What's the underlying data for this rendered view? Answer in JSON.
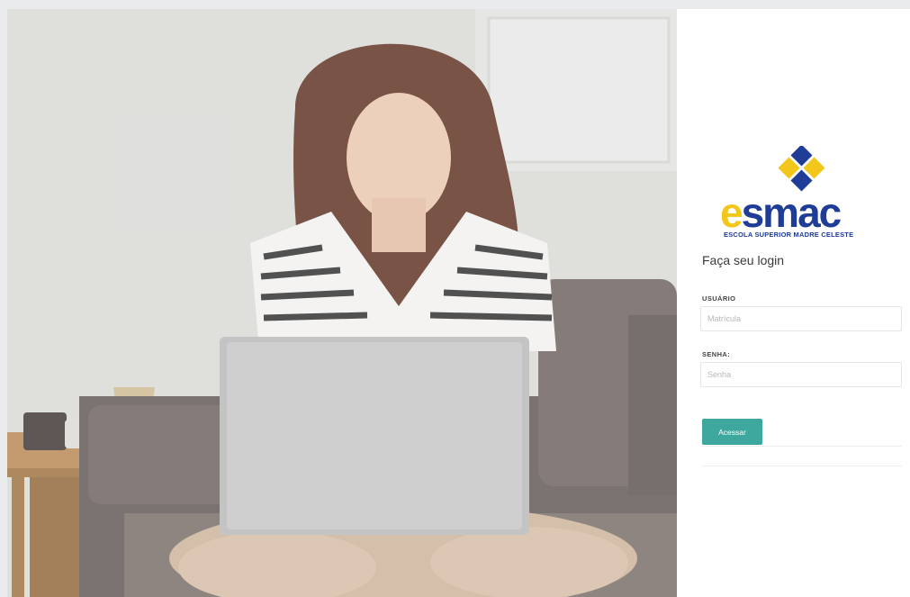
{
  "brand": {
    "logo_letter_e": "e",
    "logo_rest": "smac",
    "logo_subtitle": "ESCOLA SUPERIOR MADRE CELESTE",
    "primary_color": "#1f3c96",
    "accent_color": "#f2c61a"
  },
  "login": {
    "heading": "Faça seu login",
    "user_label": "USUÁRIO",
    "user_placeholder": "Matrícula",
    "user_value": "",
    "password_label": "SENHA:",
    "password_placeholder": "Senha",
    "password_value": "",
    "submit_label": "Acessar",
    "submit_color": "#3ea79e"
  },
  "hero": {
    "icon": "hero-photo-woman-laptop"
  }
}
